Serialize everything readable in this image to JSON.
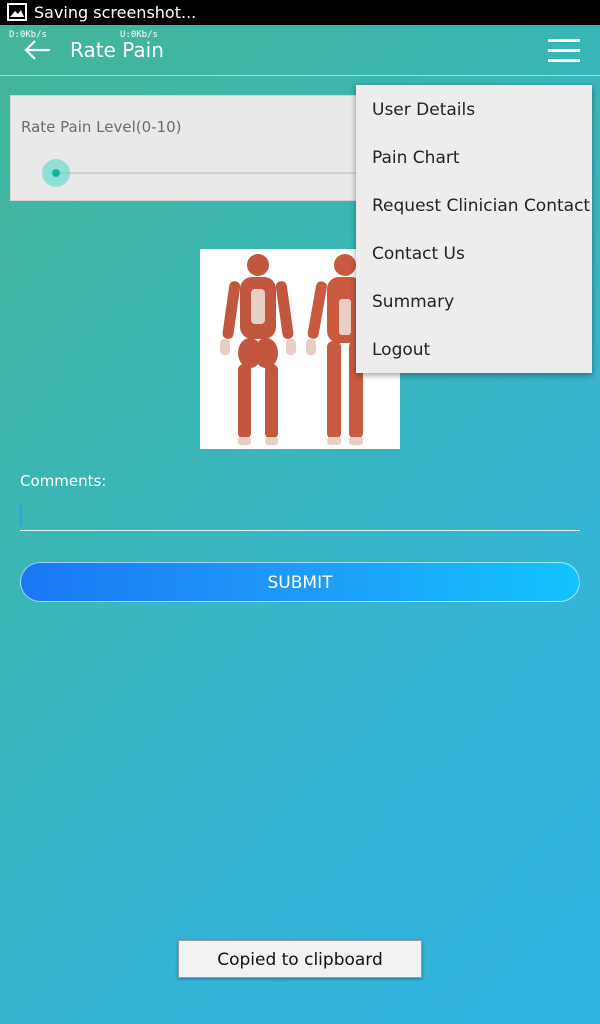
{
  "status_bar": {
    "notification_text": "Saving screenshot...",
    "icon": "image-icon"
  },
  "app_bar": {
    "network_down": "D:0Kb/s",
    "network_up": "U:0Kb/s",
    "title": "Rate Pain",
    "back_icon": "arrow-left-icon",
    "menu_icon": "hamburger-menu-icon"
  },
  "pain_card": {
    "label": "Rate Pain Level(0-10)",
    "slider_value": 0,
    "slider_max": 10
  },
  "anatomy_image": {
    "icon": "human-muscle-anatomy-image"
  },
  "comments": {
    "label": "Comments:",
    "value": ""
  },
  "submit_label": "SUBMIT",
  "menu_items": [
    "User Details",
    "Pain Chart",
    "Request Clinician Contact",
    "Contact Us",
    "Summary",
    "Logout"
  ],
  "toast": "Copied to clipboard",
  "colors": {
    "accent": "#16b39d",
    "button_start": "#1a78f5",
    "button_end": "#12c4fc"
  }
}
